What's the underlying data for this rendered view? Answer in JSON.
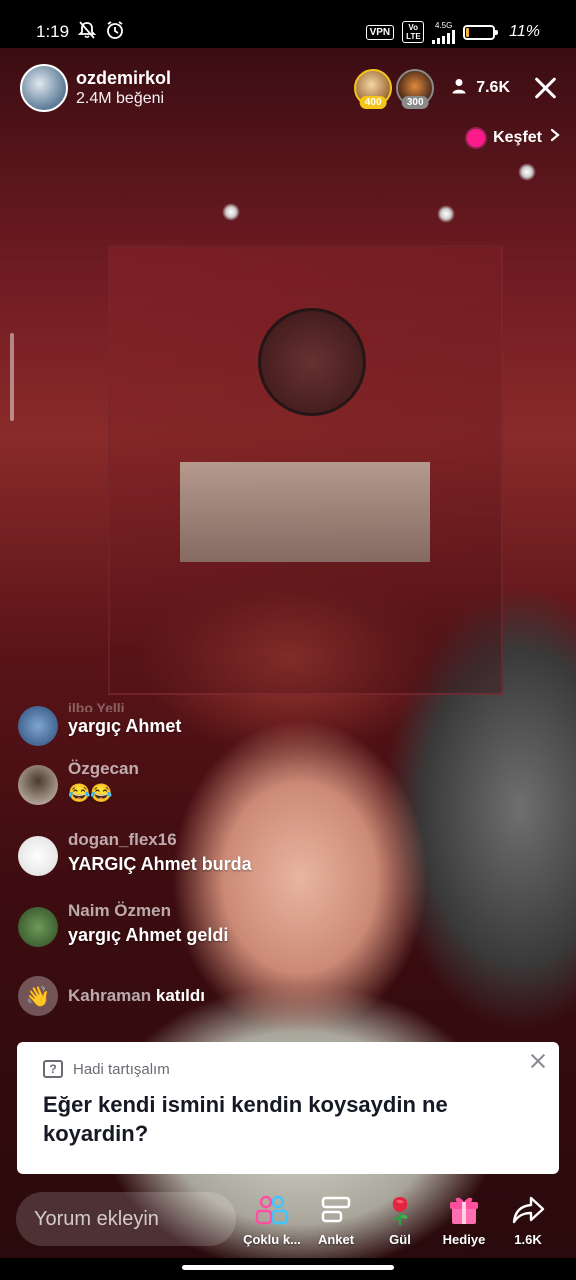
{
  "status_bar": {
    "time": "1:19",
    "vpn": "VPN",
    "volte": "Vo LTE",
    "network": "4.5G",
    "battery_percent": "11%",
    "battery_level": 0.11,
    "battery_color": "#f1b13b"
  },
  "header": {
    "host_name": "ozdemirkol",
    "likes": "2.4M beğeni",
    "badges": [
      {
        "label": "400",
        "color": "#f5c518"
      },
      {
        "label": "300",
        "color": "#8a8a8a"
      }
    ],
    "viewer_count": "7.6K"
  },
  "explore": {
    "label": "Keşfet",
    "accent": "#ff1a8c"
  },
  "comments": [
    {
      "user": "ilbo Yelli",
      "message": "yargıç Ahmet",
      "avatar_color": "#4a6fa5"
    },
    {
      "user": "Özgecan",
      "message": "😂😂",
      "avatar_color": "#6b5b4b"
    },
    {
      "user": "dogan_flex16",
      "message": "YARGIÇ Ahmet burda",
      "avatar_color": "#e8e8e8"
    },
    {
      "user": "Naim Özmen",
      "message": "yargıç Ahmet geldi",
      "avatar_color": "#3f6b3a"
    }
  ],
  "join": {
    "user": "Kahraman",
    "text": "katıldı"
  },
  "card": {
    "title": "Hadi tartışalım",
    "question": "Eğer kendi ismini kendin koysaydin ne koyardin?"
  },
  "bottom": {
    "input_placeholder": "Yorum ekleyin",
    "actions": [
      {
        "label": "Çoklu k...",
        "icon": "multi-guest-icon"
      },
      {
        "label": "Anket",
        "icon": "poll-icon"
      },
      {
        "label": "Gül",
        "icon": "rose-icon"
      },
      {
        "label": "Hediye",
        "icon": "gift-icon"
      },
      {
        "label": "1.6K",
        "icon": "share-icon"
      }
    ]
  }
}
